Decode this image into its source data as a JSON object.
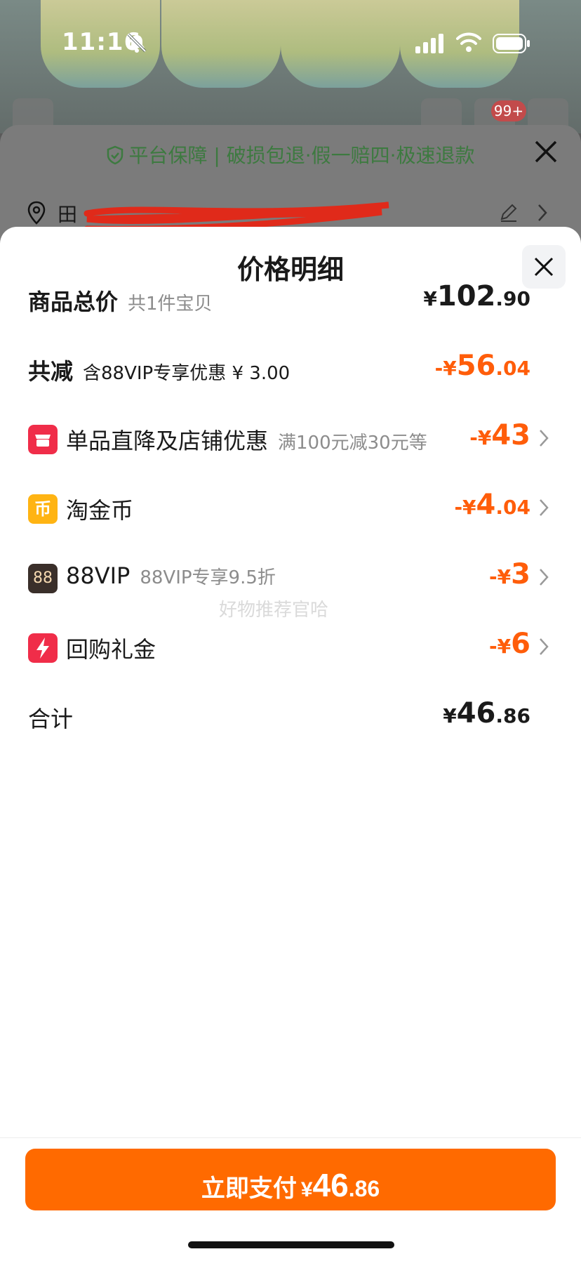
{
  "status_bar": {
    "time": "11:16"
  },
  "background": {
    "badge": "99+",
    "guarantee": "平台保障 | 破损包退·假一赔四·极速退款",
    "address_name": "田"
  },
  "sheet": {
    "title": "价格明细",
    "rows": [
      {
        "label": "商品总价",
        "sub": "共1件宝贝",
        "yen": "¥",
        "int": "102",
        "dec": ".90",
        "tone": "dark"
      },
      {
        "label": "共减",
        "sub": "含88VIP专享优惠 ¥ 3.00",
        "yen": "-¥",
        "int": "56",
        "dec": ".04",
        "tone": "orange"
      },
      {
        "label": "单品直降及店铺优惠",
        "sub": "满100元减30元等",
        "yen": "-¥",
        "int": "43",
        "dec": "",
        "tone": "orange",
        "icon": "shop-icon",
        "icon_color": "#f02d49"
      },
      {
        "label": "淘金币",
        "sub": "",
        "yen": "-¥",
        "int": "4",
        "dec": ".04",
        "tone": "orange",
        "icon": "coin-icon",
        "icon_color": "#ffb413",
        "icon_text": "币"
      },
      {
        "label": "88VIP",
        "sub": "88VIP专享9.5折",
        "yen": "-¥",
        "int": "3",
        "dec": "",
        "tone": "orange",
        "icon": "vip-icon",
        "icon_color": "#3a2f2a",
        "icon_text": "88"
      },
      {
        "label": "回购礼金",
        "sub": "",
        "yen": "-¥",
        "int": "6",
        "dec": "",
        "tone": "orange",
        "icon": "gift-icon",
        "icon_color": "#f02d49"
      },
      {
        "label": "合计",
        "sub": "",
        "yen": "¥",
        "int": "46",
        "dec": ".86",
        "tone": "dark"
      }
    ],
    "watermark": "好物推荐官哈"
  },
  "pay_button": {
    "label": "立即支付",
    "yen": "¥",
    "int": "46",
    "dec": ".86"
  },
  "colors": {
    "accent": "#ff6a00",
    "discount": "#ff5d0a",
    "guarantee": "#3d7a40"
  }
}
